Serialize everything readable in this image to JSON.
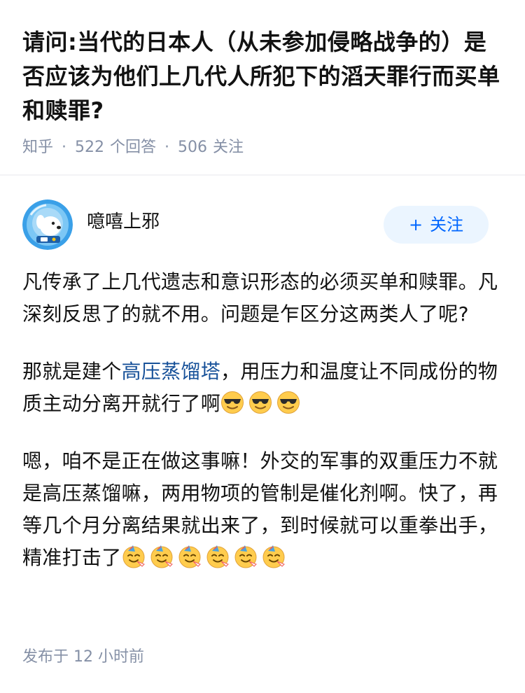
{
  "question": {
    "title": "请问:当代的日本人（从未参加侵略战争的）是否应该为他们上几代人所犯下的滔天罪行而买单和赎罪?",
    "source": "知乎",
    "separator": "·",
    "answer_count": "522",
    "answer_label": "个回答",
    "follower_count": "506",
    "follower_label": "关注"
  },
  "author": {
    "name": "噫嘻上邪",
    "avatar_icon": "dog-astronaut-avatar-icon",
    "follow_plus": "+",
    "follow_label": "关注"
  },
  "answer": {
    "p1": "凡传承了上几代遗志和意识形态的必须买单和赎罪。凡深刻反思了的就不用。问题是乍区分这两类人了呢?",
    "p2_before": "那就是建个",
    "p2_link": "高压蒸馏塔",
    "p2_after": "，用压力和温度让不同成份的物质主动分离开就行了啊",
    "p2_emoji": "sunglasses-emoji-icon",
    "p3": "嗯，咱不是正在做这事嘛！外交的军事的双重压力不就是高压蒸馏嘛，两用物项的管制是催化剂啊。快了，再等几个月分离结果就出来了，到时候就可以重拳出手，精准打击了",
    "p3_emoji": "party-face-emoji-icon"
  },
  "footer": {
    "timestamp": "发布于 12 小时前"
  },
  "colors": {
    "link": "#175199",
    "meta": "#8590a6",
    "follow_bg": "#ebf5ff",
    "follow_text": "#0066ff",
    "avatar_bg": "#3aa0e8"
  }
}
